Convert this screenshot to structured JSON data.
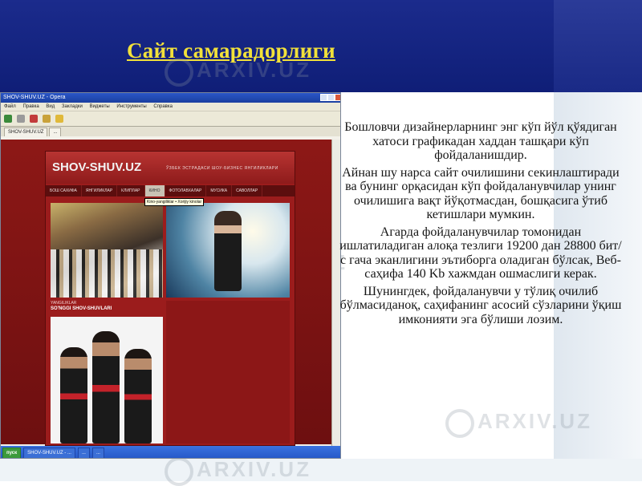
{
  "slide": {
    "title": "Сайт самарадорлиги",
    "watermark": "ARXIV.UZ",
    "colors": {
      "header": "#1b2b8c",
      "title": "#f2e13a",
      "site_red": "#9b1c1c"
    }
  },
  "browser": {
    "window_title": "SHOV-SHUV.UZ - Opera",
    "menu": [
      "Файл",
      "Правка",
      "Вид",
      "Закладки",
      "Виджеты",
      "Инструменты",
      "Справка"
    ],
    "tabs": [
      "SHOV-SHUV.UZ",
      "..."
    ],
    "toolbar_icons": [
      "back-icon",
      "forward-icon",
      "reload-icon",
      "home-icon",
      "star-icon"
    ],
    "tooltip": "Kino-yangiliklar • Xorijiy kinolar",
    "taskbar": {
      "start": "пуск",
      "items": [
        "SHOV-SHUV.UZ - ...",
        "...",
        "..."
      ]
    }
  },
  "site": {
    "logo": "SHOV-SHUV.UZ",
    "slogan": "ЎЗБЕК ЭСТРАДАСИ ШОУ-БИЗНЕС ЯНГИЛИКЛАРИ",
    "nav": [
      "БОШ САХИФА",
      "ЯНГИЛИКЛАР",
      "КЛИПЛАР",
      "КИНО",
      "ФОТОЛАВХАЛАР",
      "МУСИКА",
      "САВОЛЛАР"
    ],
    "active_nav_index": 3,
    "section_kicker": "YANGILIKLAR",
    "section_title": "SO'NGGI SHOV-SHUVLARI"
  },
  "content": {
    "paragraphs": [
      "Бошловчи дизайнерларнинг энг кўп йўл қўядиган хатоси графикадан хаддан ташқари кўп фойдаланишдир.",
      "Айнан шу нарса сайт очилишини секинлаштиради ва бунинг орқасидан кўп фойдаланувчилар унинг очилишига вақт йўқотмасдан, бошқасига ўтиб кетишлари мумкин.",
      "Агарда фойдаланувчилар томонидан ишлатиладиган алоқа тезлиги 19200 дан 28800 бит/с гача эканлигини эътиборга оладиган бўлсак, Веб-саҳифа 140 Kb хажмдан ошмаслиги керак.",
      "Шунингдек, фойдаланувчи у тўлиқ очилиб бўлмасиданоқ, саҳифанинг асосий сўзларини ўқиш имконияти эга бўлиши лозим."
    ]
  }
}
